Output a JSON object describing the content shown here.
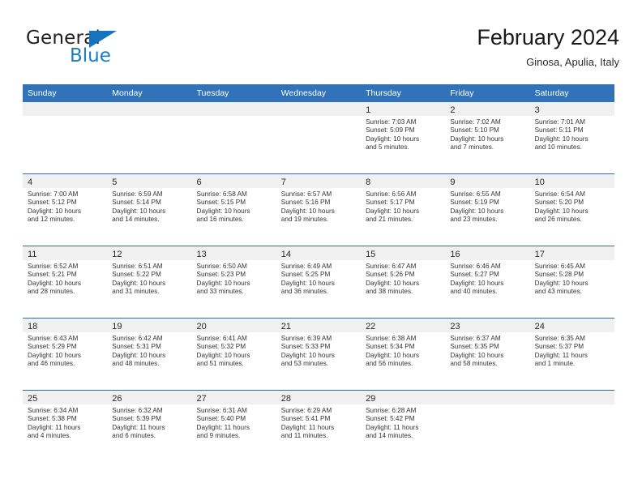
{
  "brand": {
    "name_top": "General",
    "name_bottom": "Blue",
    "triangle_color": "#1673bd",
    "blue_text_color": "#1c7cc4"
  },
  "header": {
    "title": "February 2024",
    "subtitle": "Ginosa, Apulia, Italy"
  },
  "theme": {
    "header_bar_color": "#3172b8",
    "row_rule_color": "#2e6da8",
    "day_band_color": "#f0f0f0"
  },
  "weekdays": [
    "Sunday",
    "Monday",
    "Tuesday",
    "Wednesday",
    "Thursday",
    "Friday",
    "Saturday"
  ],
  "weeks": [
    [
      {
        "day": "",
        "empty": true
      },
      {
        "day": "",
        "empty": true
      },
      {
        "day": "",
        "empty": true
      },
      {
        "day": "",
        "empty": true
      },
      {
        "day": "1",
        "sunrise": "Sunrise: 7:03 AM",
        "sunset": "Sunset: 5:09 PM",
        "daylight_1": "Daylight: 10 hours",
        "daylight_2": "and 5 minutes."
      },
      {
        "day": "2",
        "sunrise": "Sunrise: 7:02 AM",
        "sunset": "Sunset: 5:10 PM",
        "daylight_1": "Daylight: 10 hours",
        "daylight_2": "and 7 minutes."
      },
      {
        "day": "3",
        "sunrise": "Sunrise: 7:01 AM",
        "sunset": "Sunset: 5:11 PM",
        "daylight_1": "Daylight: 10 hours",
        "daylight_2": "and 10 minutes."
      }
    ],
    [
      {
        "day": "4",
        "sunrise": "Sunrise: 7:00 AM",
        "sunset": "Sunset: 5:12 PM",
        "daylight_1": "Daylight: 10 hours",
        "daylight_2": "and 12 minutes."
      },
      {
        "day": "5",
        "sunrise": "Sunrise: 6:59 AM",
        "sunset": "Sunset: 5:14 PM",
        "daylight_1": "Daylight: 10 hours",
        "daylight_2": "and 14 minutes."
      },
      {
        "day": "6",
        "sunrise": "Sunrise: 6:58 AM",
        "sunset": "Sunset: 5:15 PM",
        "daylight_1": "Daylight: 10 hours",
        "daylight_2": "and 16 minutes."
      },
      {
        "day": "7",
        "sunrise": "Sunrise: 6:57 AM",
        "sunset": "Sunset: 5:16 PM",
        "daylight_1": "Daylight: 10 hours",
        "daylight_2": "and 19 minutes."
      },
      {
        "day": "8",
        "sunrise": "Sunrise: 6:56 AM",
        "sunset": "Sunset: 5:17 PM",
        "daylight_1": "Daylight: 10 hours",
        "daylight_2": "and 21 minutes."
      },
      {
        "day": "9",
        "sunrise": "Sunrise: 6:55 AM",
        "sunset": "Sunset: 5:19 PM",
        "daylight_1": "Daylight: 10 hours",
        "daylight_2": "and 23 minutes."
      },
      {
        "day": "10",
        "sunrise": "Sunrise: 6:54 AM",
        "sunset": "Sunset: 5:20 PM",
        "daylight_1": "Daylight: 10 hours",
        "daylight_2": "and 26 minutes."
      }
    ],
    [
      {
        "day": "11",
        "sunrise": "Sunrise: 6:52 AM",
        "sunset": "Sunset: 5:21 PM",
        "daylight_1": "Daylight: 10 hours",
        "daylight_2": "and 28 minutes."
      },
      {
        "day": "12",
        "sunrise": "Sunrise: 6:51 AM",
        "sunset": "Sunset: 5:22 PM",
        "daylight_1": "Daylight: 10 hours",
        "daylight_2": "and 31 minutes."
      },
      {
        "day": "13",
        "sunrise": "Sunrise: 6:50 AM",
        "sunset": "Sunset: 5:23 PM",
        "daylight_1": "Daylight: 10 hours",
        "daylight_2": "and 33 minutes."
      },
      {
        "day": "14",
        "sunrise": "Sunrise: 6:49 AM",
        "sunset": "Sunset: 5:25 PM",
        "daylight_1": "Daylight: 10 hours",
        "daylight_2": "and 36 minutes."
      },
      {
        "day": "15",
        "sunrise": "Sunrise: 6:47 AM",
        "sunset": "Sunset: 5:26 PM",
        "daylight_1": "Daylight: 10 hours",
        "daylight_2": "and 38 minutes."
      },
      {
        "day": "16",
        "sunrise": "Sunrise: 6:46 AM",
        "sunset": "Sunset: 5:27 PM",
        "daylight_1": "Daylight: 10 hours",
        "daylight_2": "and 40 minutes."
      },
      {
        "day": "17",
        "sunrise": "Sunrise: 6:45 AM",
        "sunset": "Sunset: 5:28 PM",
        "daylight_1": "Daylight: 10 hours",
        "daylight_2": "and 43 minutes."
      }
    ],
    [
      {
        "day": "18",
        "sunrise": "Sunrise: 6:43 AM",
        "sunset": "Sunset: 5:29 PM",
        "daylight_1": "Daylight: 10 hours",
        "daylight_2": "and 46 minutes."
      },
      {
        "day": "19",
        "sunrise": "Sunrise: 6:42 AM",
        "sunset": "Sunset: 5:31 PM",
        "daylight_1": "Daylight: 10 hours",
        "daylight_2": "and 48 minutes."
      },
      {
        "day": "20",
        "sunrise": "Sunrise: 6:41 AM",
        "sunset": "Sunset: 5:32 PM",
        "daylight_1": "Daylight: 10 hours",
        "daylight_2": "and 51 minutes."
      },
      {
        "day": "21",
        "sunrise": "Sunrise: 6:39 AM",
        "sunset": "Sunset: 5:33 PM",
        "daylight_1": "Daylight: 10 hours",
        "daylight_2": "and 53 minutes."
      },
      {
        "day": "22",
        "sunrise": "Sunrise: 6:38 AM",
        "sunset": "Sunset: 5:34 PM",
        "daylight_1": "Daylight: 10 hours",
        "daylight_2": "and 56 minutes."
      },
      {
        "day": "23",
        "sunrise": "Sunrise: 6:37 AM",
        "sunset": "Sunset: 5:35 PM",
        "daylight_1": "Daylight: 10 hours",
        "daylight_2": "and 58 minutes."
      },
      {
        "day": "24",
        "sunrise": "Sunrise: 6:35 AM",
        "sunset": "Sunset: 5:37 PM",
        "daylight_1": "Daylight: 11 hours",
        "daylight_2": "and 1 minute."
      }
    ],
    [
      {
        "day": "25",
        "sunrise": "Sunrise: 6:34 AM",
        "sunset": "Sunset: 5:38 PM",
        "daylight_1": "Daylight: 11 hours",
        "daylight_2": "and 4 minutes."
      },
      {
        "day": "26",
        "sunrise": "Sunrise: 6:32 AM",
        "sunset": "Sunset: 5:39 PM",
        "daylight_1": "Daylight: 11 hours",
        "daylight_2": "and 6 minutes."
      },
      {
        "day": "27",
        "sunrise": "Sunrise: 6:31 AM",
        "sunset": "Sunset: 5:40 PM",
        "daylight_1": "Daylight: 11 hours",
        "daylight_2": "and 9 minutes."
      },
      {
        "day": "28",
        "sunrise": "Sunrise: 6:29 AM",
        "sunset": "Sunset: 5:41 PM",
        "daylight_1": "Daylight: 11 hours",
        "daylight_2": "and 11 minutes."
      },
      {
        "day": "29",
        "sunrise": "Sunrise: 6:28 AM",
        "sunset": "Sunset: 5:42 PM",
        "daylight_1": "Daylight: 11 hours",
        "daylight_2": "and 14 minutes."
      },
      {
        "day": "",
        "empty": true
      },
      {
        "day": "",
        "empty": true
      }
    ]
  ]
}
